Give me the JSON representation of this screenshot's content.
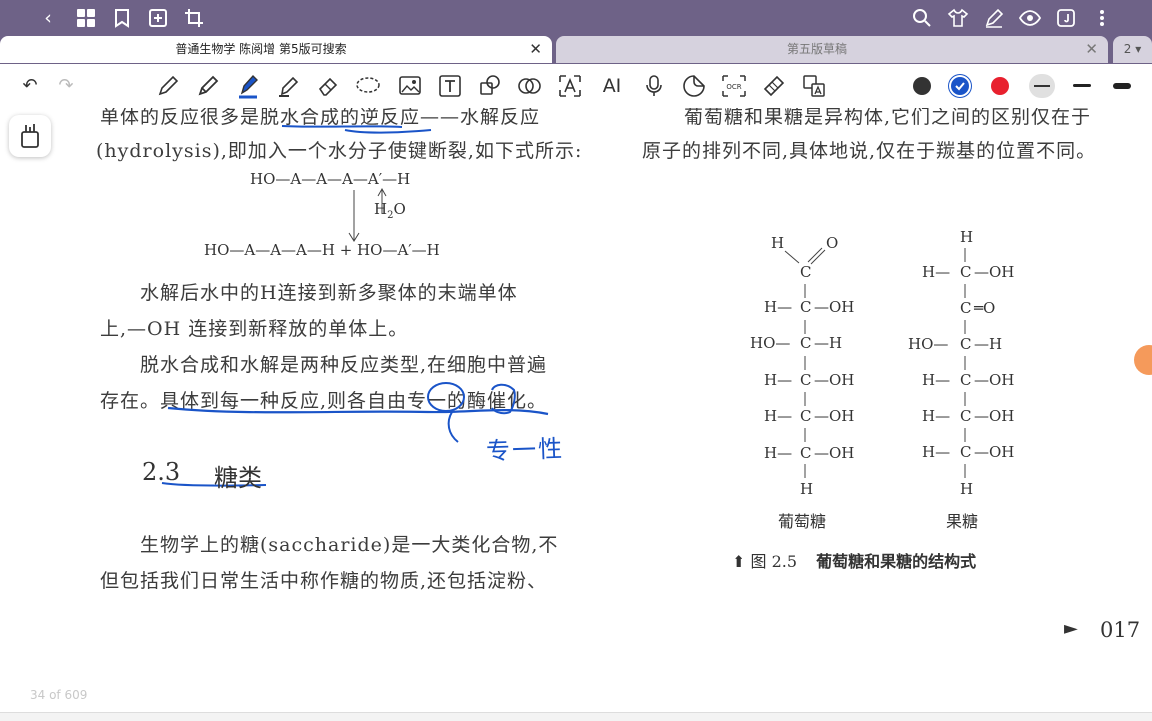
{
  "topbar": {
    "icons": [
      "back-icon",
      "grid-icon",
      "bookmark-icon",
      "add-page-icon",
      "crop-icon",
      "search-icon",
      "tshirt-icon",
      "pen-edit-icon",
      "eye-icon",
      "reader-icon",
      "more-icon"
    ]
  },
  "tabs": [
    {
      "label": "普通生物学 陈阅增 第5版可搜索",
      "close": "✕",
      "active": true
    },
    {
      "label": "第五版草稿",
      "close": "✕",
      "active": false
    }
  ],
  "tab_count": "2 ▾",
  "toolbar": {
    "tools": [
      "undo-icon",
      "redo-icon",
      "pencil-icon",
      "pen-icon",
      "highlighter-pen-icon",
      "marker-icon",
      "eraser-icon",
      "lasso-icon",
      "image-icon",
      "text-box-icon",
      "shape-icon",
      "link-icon",
      "text-select-icon",
      "ai-icon",
      "microphone-icon",
      "sticker-icon",
      "ocr-icon",
      "tape-icon",
      "translate-icon"
    ],
    "ai_label": "AI",
    "ocr_label": "OCR",
    "colors": {
      "black": "#333333",
      "blue": "#1a54c8",
      "red": "#e8202e",
      "gray": "#e0e0e0"
    }
  },
  "left": {
    "line1": "单体的反应很多是脱水合成的逆反应——水解反应",
    "line2": "(hydrolysis),即加入一个水分子使键断裂,如下式所示:",
    "eq_top": "HO—A—A—A—A′—H",
    "eq_water": "H",
    "eq_water_sub": "2",
    "eq_water_o": "O",
    "eq_bottom": "HO—A—A—A—H  +  HO—A′—H",
    "p2_l1": "水解后水中的H连接到新多聚体的末端单体",
    "p2_l2": "上,—OH 连接到新释放的单体上。",
    "p3_l1": "脱水合成和水解是两种反应类型,在细胞中普遍",
    "p3_l2": "存在。具体到每一种反应,则各自由专一的酶催化。",
    "handwriting": "专一性",
    "section_num": "2.3",
    "section_title": "糖类",
    "p4_l1": "生物学上的糖(saccharide)是一大类化合物,不",
    "p4_l2": "但包括我们日常生活中称作糖的物质,还包括淀粉、"
  },
  "right": {
    "line1": "葡萄糖和果糖是异构体,它们之间的区别仅在于",
    "line2": "原子的排列不同,具体地说,仅在于羰基的位置不同。",
    "glucose": {
      "name": "葡萄糖",
      "rows": [
        {
          "left": "",
          "center": "C",
          "right": ""
        },
        {
          "left": "H—",
          "center": "C",
          "right": "—OH"
        },
        {
          "left": "HO—",
          "center": "C",
          "right": "—H"
        },
        {
          "left": "H—",
          "center": "C",
          "right": "—OH"
        },
        {
          "left": "H—",
          "center": "C",
          "right": "—OH"
        },
        {
          "left": "H—",
          "center": "C",
          "right": "—OH"
        },
        {
          "left": "",
          "center": "H",
          "right": ""
        }
      ],
      "top_h": "H",
      "top_o": "O"
    },
    "fructose": {
      "name": "果糖",
      "rows": [
        {
          "left": "",
          "center": "H",
          "right": ""
        },
        {
          "left": "H—",
          "center": "C",
          "right": "—OH"
        },
        {
          "left": "",
          "center": "C",
          "right": "═O"
        },
        {
          "left": "HO—",
          "center": "C",
          "right": "—H"
        },
        {
          "left": "H—",
          "center": "C",
          "right": "—OH"
        },
        {
          "left": "H—",
          "center": "C",
          "right": "—OH"
        },
        {
          "left": "H—",
          "center": "C",
          "right": "—OH"
        },
        {
          "left": "",
          "center": "H",
          "right": ""
        }
      ]
    },
    "caption_fig": "图 2.5",
    "caption_text": "葡萄糖和果糖的结构式",
    "page_arrow": "►",
    "page_number": "017"
  },
  "status": {
    "page_indicator": "34 of 609"
  }
}
